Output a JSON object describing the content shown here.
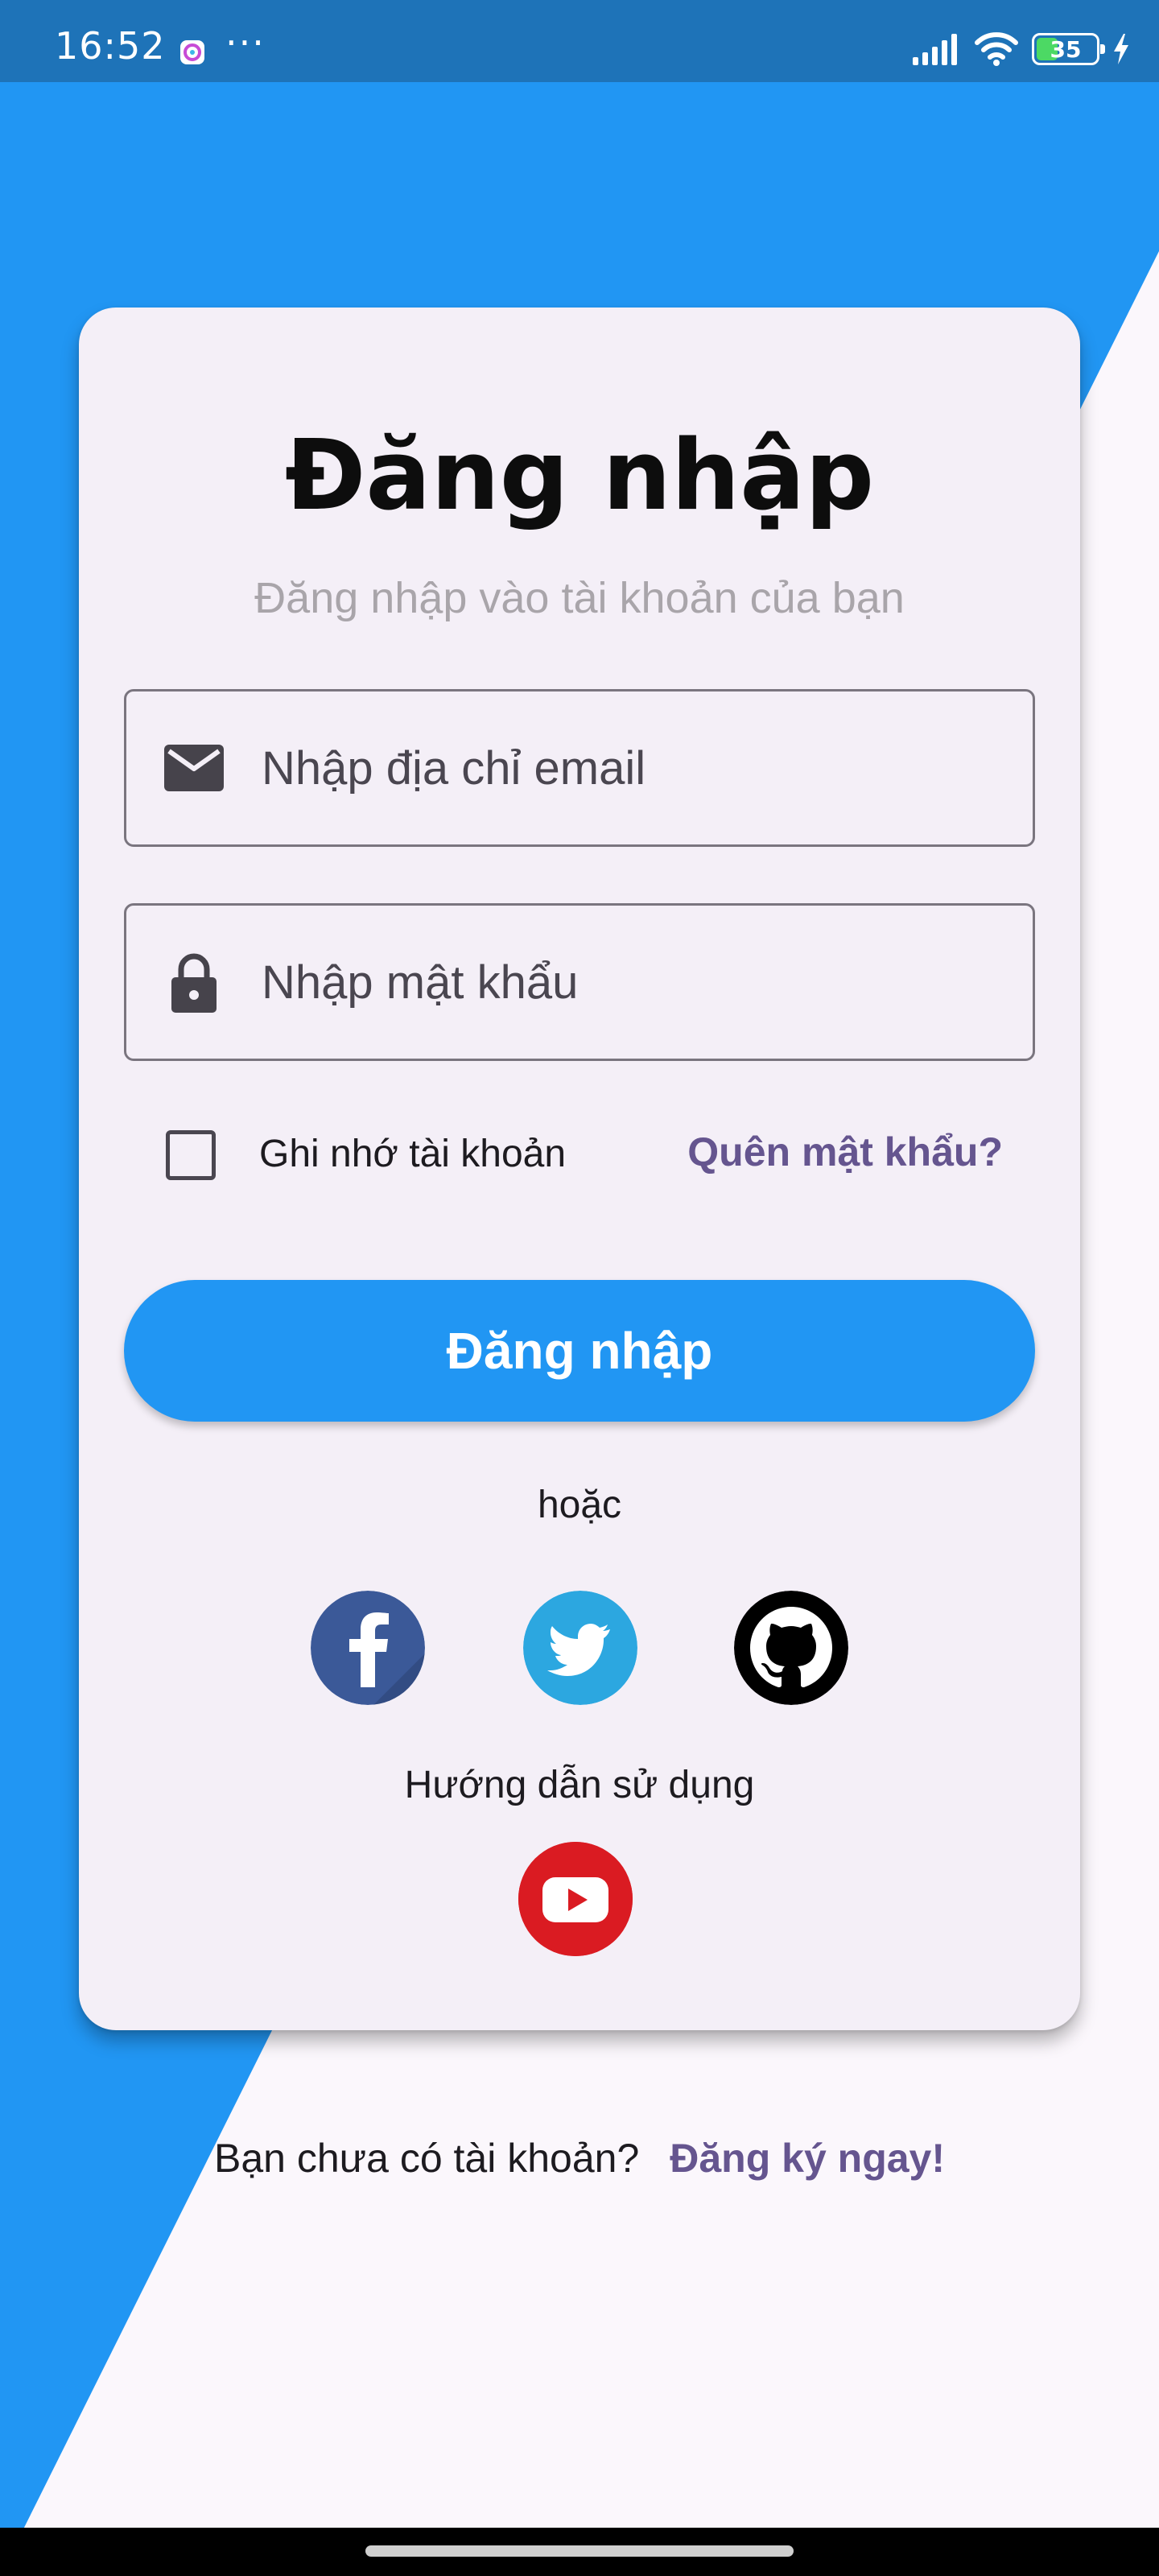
{
  "status_bar": {
    "time": "16:52",
    "more_indicator": "···",
    "battery_level": "35",
    "icons": [
      "app-notification-icon",
      "signal-icon",
      "wifi-icon",
      "battery-icon",
      "charging-icon"
    ]
  },
  "login": {
    "title": "Đăng nhập",
    "subtitle": "Đăng nhập vào tài khoản của bạn",
    "email_placeholder": "Nhập địa chỉ email",
    "password_placeholder": "Nhập mật khẩu",
    "remember_label": "Ghi nhớ tài khoản",
    "remember_checked": false,
    "forgot_password": "Quên mật khẩu?",
    "submit_label": "Đăng nhập",
    "or_text": "hoặc",
    "social": [
      "facebook",
      "twitter",
      "github"
    ],
    "guide_text": "Hướng dẫn sử dụng",
    "guide_icon": "youtube"
  },
  "signup": {
    "prompt": "Bạn chưa có tài khoản?",
    "link": "Đăng ký ngay!"
  },
  "colors": {
    "primary": "#2196f3",
    "status_bar": "#1e73b8",
    "link": "#65558f",
    "card": "#f4eff7",
    "background": "#fbf7fc",
    "facebook": "#3b5998",
    "twitter": "#2ca7e0",
    "github": "#000000",
    "youtube": "#da1b22"
  }
}
